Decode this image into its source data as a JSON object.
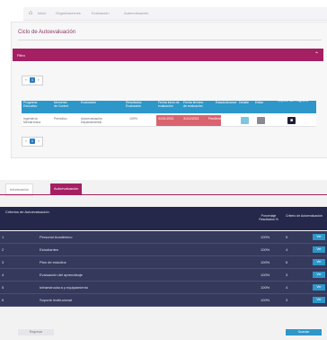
{
  "breadcrumb": [
    "Inicio",
    "Organizaciones",
    "Evaluación",
    "Autoevaluación"
  ],
  "page_title": "Ciclo de Autoevaluación",
  "filter_panel": {
    "header": "Filtro",
    "collapse_icon": "chevron-up-icon"
  },
  "pager_top": {
    "prev": "«",
    "current": "1",
    "next": "»"
  },
  "table": {
    "columns": [
      "Programa Educativo",
      "Momento de Control",
      "Evaluación",
      "Resultados Evaluación",
      "Fecha inicio de evaluación",
      "Fecha término de evaluación",
      "Estado/Avance",
      "Detalle",
      "Editar",
      "Reporte del Programa"
    ],
    "rows": [
      {
        "programa": "Ingeniería Mecatrónica",
        "momento": "Periódico",
        "evaluacion": "Autoevaluación Departamental",
        "resultados": "100%",
        "inicio": "01/01/2021",
        "termino": "31/12/2021",
        "estado": "Pendiente"
      }
    ]
  },
  "pager_bottom": {
    "prev": "«",
    "current": "1",
    "next": "»"
  },
  "tabs": [
    "Información",
    "Autoevaluación"
  ],
  "criteria": {
    "title": "Criterios de Autoevaluación",
    "col_pct": "Porcentaje Resultados %",
    "col_crit": "Criterio de Autoevaluación",
    "rows": [
      {
        "num": "1",
        "name": "Personal Académico",
        "pct": "100%",
        "count": "5",
        "btn": "Ver"
      },
      {
        "num": "2",
        "name": "Estudiantes",
        "pct": "100%",
        "count": "4",
        "btn": "Ver"
      },
      {
        "num": "3",
        "name": "Plan de estudios",
        "pct": "100%",
        "count": "6",
        "btn": "Ver"
      },
      {
        "num": "4",
        "name": "Evaluación del aprendizaje",
        "pct": "100%",
        "count": "3",
        "btn": "Ver"
      },
      {
        "num": "5",
        "name": "Infraestructura y equipamiento",
        "pct": "100%",
        "count": "4",
        "btn": "Ver"
      },
      {
        "num": "6",
        "name": "Soporte institucional",
        "pct": "100%",
        "count": "3",
        "btn": "Ver"
      }
    ]
  },
  "footer": {
    "back": "Regresar",
    "save": "Guardar"
  },
  "colors": {
    "accent": "#a51f63",
    "table_head": "#2d97c9",
    "dark": "#25284a",
    "alert": "#d9636e"
  }
}
